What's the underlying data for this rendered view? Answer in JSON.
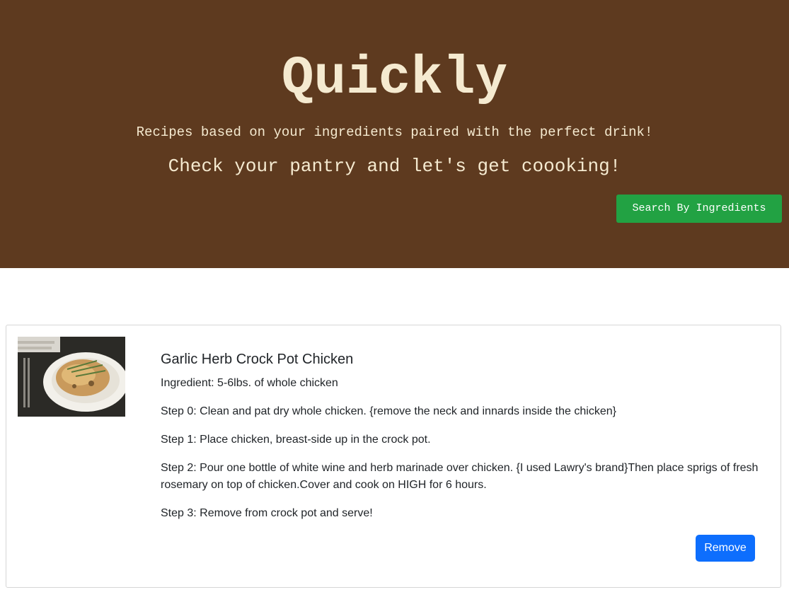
{
  "hero": {
    "title": "Quickly",
    "subtitle": "Recipes based on your ingredients paired with the perfect drink!",
    "cta": "Check your pantry and let's get coooking!",
    "search_button": "Search By Ingredients",
    "background_color": "#5e3a1f",
    "text_color": "#f5ead0",
    "button_color": "#22a243"
  },
  "recipe": {
    "image_icon": "recipe-photo-garlic-herb-chicken",
    "title": "Garlic Herb Crock Pot Chicken",
    "ingredient": "Ingredient: 5-6lbs. of whole chicken",
    "steps": [
      "Step 0: Clean and pat dry whole chicken. {remove the neck and innards inside the chicken}",
      "Step 1: Place chicken, breast-side up in the crock pot.",
      "Step 2: Pour one bottle of white wine and herb marinade over chicken. {I used Lawry's brand}Then place sprigs of fresh rosemary on top of chicken.Cover and cook on HIGH for 6 hours.",
      "Step 3: Remove from crock pot and serve!"
    ],
    "remove_button": "Remove",
    "remove_button_color": "#0d6efd"
  }
}
